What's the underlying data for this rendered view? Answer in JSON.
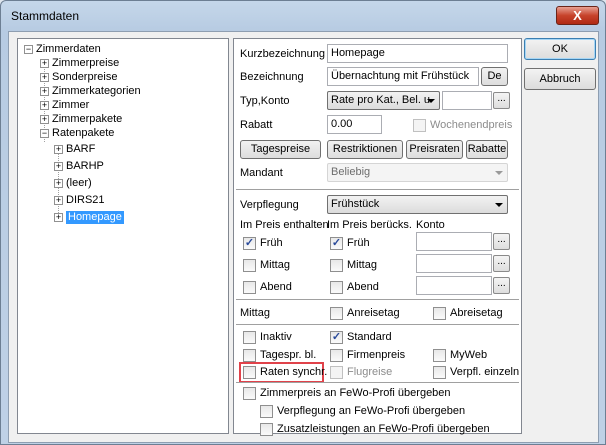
{
  "window": {
    "title": "Stammdaten",
    "close": "X"
  },
  "tree": {
    "root": "Zimmerdaten",
    "items": [
      "Zimmerpreise",
      "Sonderpreise",
      "Zimmerkategorien",
      "Zimmer",
      "Zimmerpakete",
      "Ratenpakete"
    ],
    "subitems": [
      "BARF",
      "BARHP",
      "(leer)",
      "DIRS21",
      "Homepage"
    ]
  },
  "form": {
    "kurz_label": "Kurzbezeichnung",
    "kurz_value": "Homepage",
    "bez_label": "Bezeichnung",
    "bez_value": "Übernachtung mit Frühstück",
    "lang_button": "De",
    "typ_label": "Typ,Konto",
    "typ_value": "Rate pro Kat., Bel. u",
    "dots": "...",
    "rabatt_label": "Rabatt",
    "rabatt_value": "0.00",
    "wochenend_label": "Wochenendpreis",
    "btn_tagespreise": "Tagespreise",
    "btn_restriktionen": "Restriktionen",
    "btn_preisraten": "Preisraten",
    "btn_rabatte": "Rabatte",
    "mandant_label": "Mandant",
    "mandant_value": "Beliebig",
    "verpflegung_label": "Verpflegung",
    "verpflegung_value": "Frühstück",
    "col_enthalten": "Im Preis enthalten",
    "col_beruecks": "Im Preis berücks.",
    "col_konto": "Konto",
    "meals": [
      "Früh",
      "Mittag",
      "Abend"
    ],
    "mittag_label": "Mittag",
    "anreisetag": "Anreisetag",
    "abreisetag": "Abreisetag",
    "inaktiv": "Inaktiv",
    "standard": "Standard",
    "tagespr": "Tagespr. bl.",
    "firmenpreis": "Firmenpreis",
    "myweb": "MyWeb",
    "raten_synchr": "Raten synchr.",
    "flugreise": "Flugreise",
    "verpfl_einzeln": "Verpfl. einzeln",
    "fewo_zimmer": "Zimmerpreis an FeWo-Profi übergeben",
    "fewo_verpflegung": "Verpflegung an FeWo-Profi übergeben",
    "fewo_zusatz": "Zusatzleistungen an FeWo-Profi übergeben"
  },
  "buttons": {
    "ok": "OK",
    "abbruch": "Abbruch"
  },
  "check_mark": "✓"
}
